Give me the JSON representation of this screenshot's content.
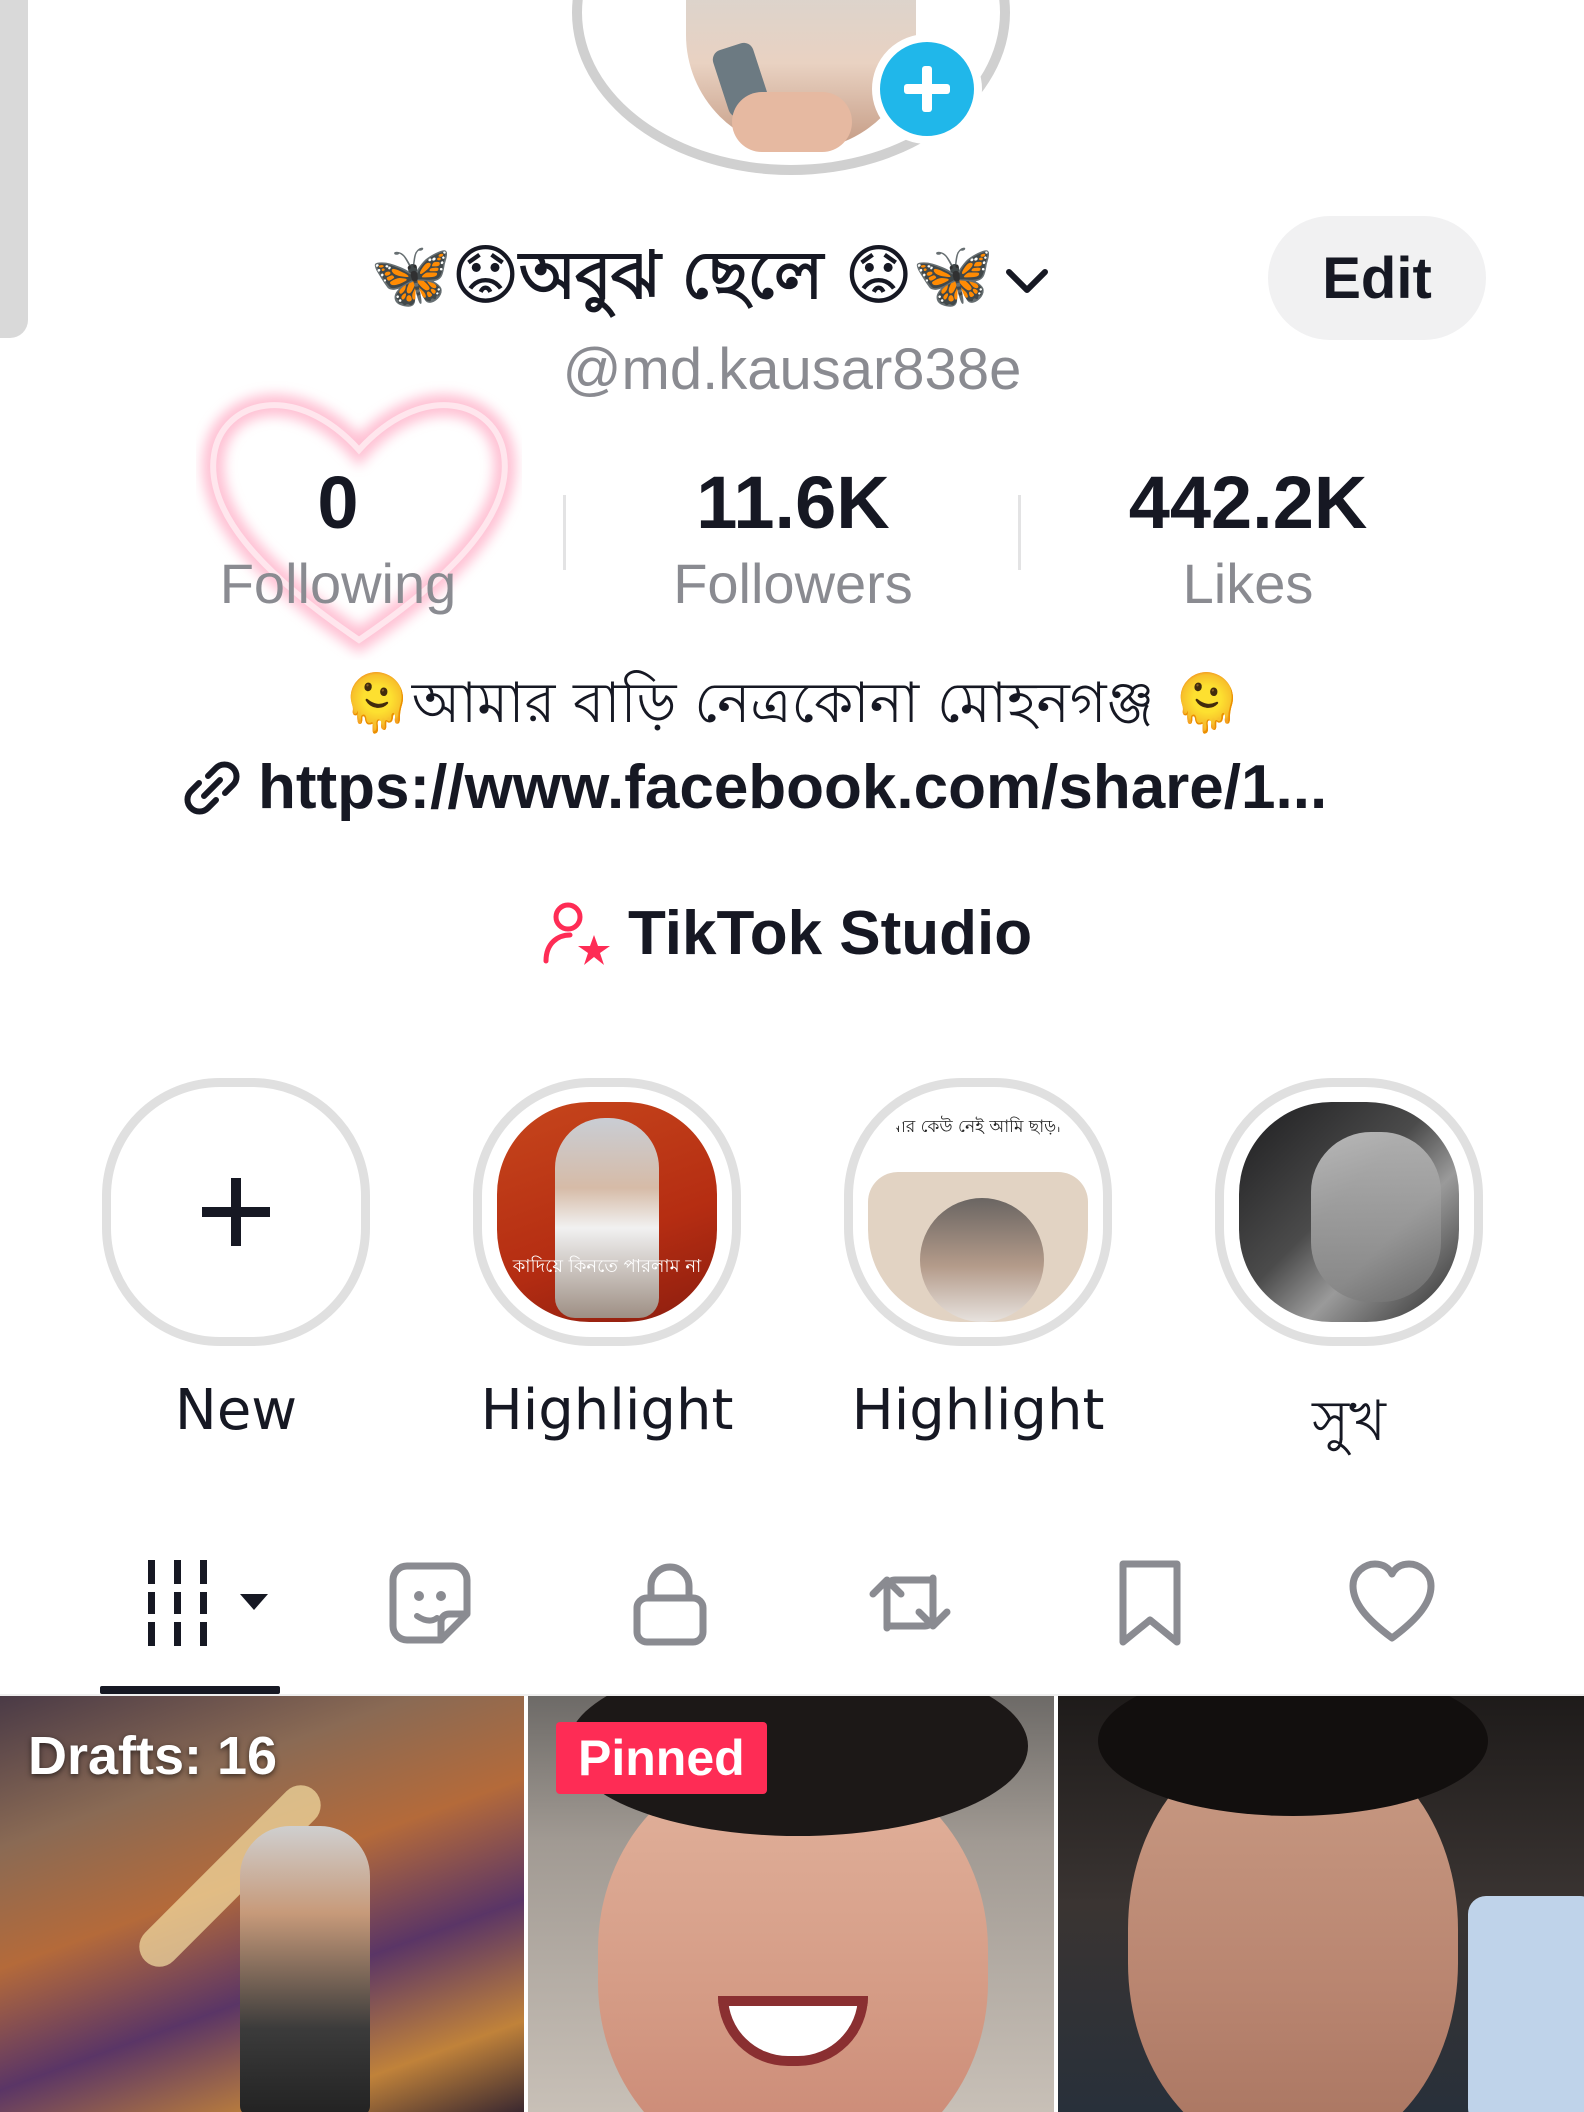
{
  "profile": {
    "display_name": "🦋😟অবুঝ ছেলে 😟🦋",
    "username": "@md.kausar838e",
    "edit_label": "Edit"
  },
  "stats": [
    {
      "value": "0",
      "label": "Following"
    },
    {
      "value": "11.6K",
      "label": "Followers"
    },
    {
      "value": "442.2K",
      "label": "Likes"
    }
  ],
  "bio": {
    "text": "🫠আমার বাড়ি নেত্রকোনা মোহনগঞ্জ 🫠",
    "link": "https://www.facebook.com/share/1..."
  },
  "studio": {
    "label": "TikTok Studio"
  },
  "highlights": [
    {
      "label": "New"
    },
    {
      "label": "Highlight",
      "caption": "কাদিয়ে কিনতে পারলাম না"
    },
    {
      "label": "Highlight",
      "caption": "আমার কেউ নেই আমি ছাড়া 😢"
    },
    {
      "label": "সুখ"
    }
  ],
  "tabs": [
    "videos-icon",
    "sticker-icon",
    "lock-icon",
    "repost-icon",
    "bookmark-icon",
    "heart-icon"
  ],
  "grid": {
    "drafts_label": "Drafts: 16",
    "pinned_label": "Pinned"
  },
  "colors": {
    "accent_blue": "#20b7ea",
    "pinned_red": "#fe2c55",
    "studio_pink": "#fe2c55"
  }
}
